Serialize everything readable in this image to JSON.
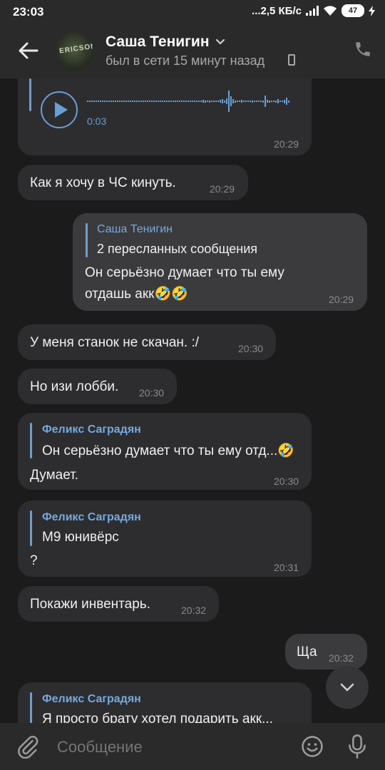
{
  "status_bar": {
    "time": "23:03",
    "speed": "...2,5 КБ/с",
    "battery": "47"
  },
  "header": {
    "name": "Саша Тенигин",
    "last_seen": "был в сети 15 минут назад",
    "avatar_text": "ERICSON"
  },
  "voice_message": {
    "duration": "0:03",
    "time": "20:29"
  },
  "messages": [
    {
      "text": "Как я хочу в ЧС кинуть.",
      "time": "20:29"
    },
    {
      "fwd_name": "Саша Тенигин",
      "fwd_count": "2 пересланных сообщения",
      "text_line1": "Он серьёзно думает что ты ему",
      "text_line2": "отдашь акк🤣🤣",
      "time": "20:29"
    },
    {
      "text": "У меня станок не скачан. :/",
      "time": "20:30"
    },
    {
      "text": "Но изи лобби.",
      "time": "20:30"
    },
    {
      "fwd_name": "Феликс Саградян",
      "quote": "Он серьёзно думает что ты ему отд...🤣",
      "text": "Думает.",
      "time": "20:30"
    },
    {
      "fwd_name": "Феликс Саградян",
      "quote": "M9 юнивёрс",
      "text": "?",
      "time": "20:31"
    },
    {
      "text": "Покажи инвентарь.",
      "time": "20:32"
    },
    {
      "text": "Ща",
      "time": "20:32"
    },
    {
      "fwd_name": "Феликс Саградян",
      "quote": "Я просто брату хотел подарить акк..."
    }
  ],
  "input": {
    "placeholder": "Сообщение"
  }
}
